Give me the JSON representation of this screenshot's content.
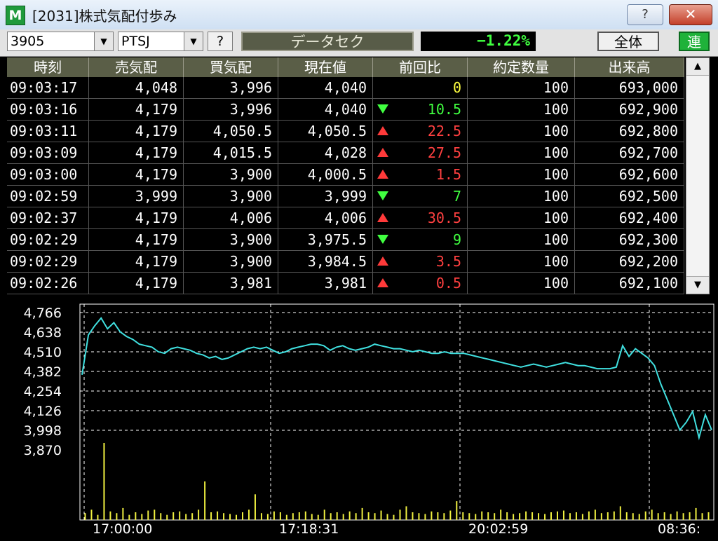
{
  "window": {
    "title": "[2031]株式気配付歩み",
    "app_icon": "M",
    "help_label": "?",
    "close_label": "✕"
  },
  "toolbar": {
    "code": "3905",
    "market": "PTSJ",
    "question_label": "?",
    "stock_name": "データセク",
    "change": "−1.22%",
    "all_label": "全体",
    "link_label": "連"
  },
  "table": {
    "headers": [
      "時刻",
      "売気配",
      "買気配",
      "現在値",
      "前回比",
      "約定数量",
      "出来高"
    ],
    "rows": [
      {
        "time": "09:03:17",
        "ask": "4,048",
        "bid": "3,996",
        "price": "4,040",
        "dir": "zero",
        "diff": "0",
        "qty": "100",
        "volume": "693,000"
      },
      {
        "time": "09:03:16",
        "ask": "4,179",
        "bid": "3,996",
        "price": "4,040",
        "dir": "dn",
        "diff": "10.5",
        "qty": "100",
        "volume": "692,900"
      },
      {
        "time": "09:03:11",
        "ask": "4,179",
        "bid": "4,050.5",
        "price": "4,050.5",
        "dir": "up",
        "diff": "22.5",
        "qty": "100",
        "volume": "692,800"
      },
      {
        "time": "09:03:09",
        "ask": "4,179",
        "bid": "4,015.5",
        "price": "4,028",
        "dir": "up",
        "diff": "27.5",
        "qty": "100",
        "volume": "692,700"
      },
      {
        "time": "09:03:00",
        "ask": "4,179",
        "bid": "3,900",
        "price": "4,000.5",
        "dir": "up",
        "diff": "1.5",
        "qty": "100",
        "volume": "692,600"
      },
      {
        "time": "09:02:59",
        "ask": "3,999",
        "bid": "3,900",
        "price": "3,999",
        "dir": "dn",
        "diff": "7",
        "qty": "100",
        "volume": "692,500"
      },
      {
        "time": "09:02:37",
        "ask": "4,179",
        "bid": "4,006",
        "price": "4,006",
        "dir": "up",
        "diff": "30.5",
        "qty": "100",
        "volume": "692,400"
      },
      {
        "time": "09:02:29",
        "ask": "4,179",
        "bid": "3,900",
        "price": "3,975.5",
        "dir": "dn",
        "diff": "9",
        "qty": "100",
        "volume": "692,300"
      },
      {
        "time": "09:02:29",
        "ask": "4,179",
        "bid": "3,900",
        "price": "3,984.5",
        "dir": "up",
        "diff": "3.5",
        "qty": "100",
        "volume": "692,200"
      },
      {
        "time": "09:02:26",
        "ask": "4,179",
        "bid": "3,981",
        "price": "3,981",
        "dir": "up",
        "diff": "0.5",
        "qty": "100",
        "volume": "692,100"
      }
    ]
  },
  "scrollbar": {
    "up_arrow": "▲",
    "down_arrow": "▼"
  },
  "colors": {
    "price_line": "#40e0e0",
    "volume_bar": "#f0f040",
    "grid": "#ffffff",
    "up": "#ff4040",
    "down": "#40ff40",
    "unchanged": "#ffff40"
  },
  "chart_data": {
    "type": "line",
    "y_ticks": [
      "4,766",
      "4,638",
      "4,510",
      "4,382",
      "4,254",
      "4,126",
      "3,998",
      "3,870"
    ],
    "y_tick_values": [
      4766,
      4638,
      4510,
      4382,
      4254,
      4126,
      3998,
      3870
    ],
    "x_ticks": [
      "17:00:00",
      "17:18:31",
      "20:02:59",
      "08:36:"
    ],
    "ylim": [
      3870,
      4766
    ],
    "price_series": [
      4360,
      4620,
      4680,
      4730,
      4660,
      4700,
      4640,
      4610,
      4590,
      4560,
      4550,
      4540,
      4510,
      4500,
      4530,
      4540,
      4530,
      4520,
      4500,
      4490,
      4470,
      4480,
      4460,
      4470,
      4490,
      4510,
      4530,
      4540,
      4530,
      4540,
      4520,
      4500,
      4510,
      4530,
      4540,
      4550,
      4560,
      4560,
      4550,
      4520,
      4540,
      4550,
      4530,
      4520,
      4530,
      4540,
      4560,
      4550,
      4540,
      4530,
      4530,
      4520,
      4510,
      4520,
      4510,
      4500,
      4500,
      4510,
      4500,
      4500,
      4500,
      4490,
      4480,
      4470,
      4460,
      4450,
      4440,
      4430,
      4420,
      4410,
      4420,
      4430,
      4420,
      4410,
      4420,
      4430,
      4440,
      4430,
      4420,
      4420,
      4410,
      4400,
      4400,
      4400,
      4410,
      4550,
      4480,
      4530,
      4500,
      4470,
      4420,
      4300,
      4200,
      4100,
      4000,
      4050,
      4120,
      3950,
      4100,
      4000
    ],
    "volume_series": [
      8,
      12,
      6,
      90,
      10,
      8,
      14,
      6,
      9,
      7,
      11,
      12,
      8,
      6,
      9,
      10,
      7,
      8,
      12,
      45,
      9,
      10,
      8,
      7,
      6,
      9,
      12,
      30,
      8,
      7,
      10,
      9,
      6,
      8,
      9,
      10,
      7,
      6,
      12,
      8,
      9,
      7,
      10,
      8,
      14,
      9,
      8,
      11,
      7,
      6,
      12,
      16,
      9,
      8,
      7,
      10,
      9,
      8,
      11,
      22,
      9,
      8,
      7,
      10,
      9,
      8,
      12,
      9,
      7,
      8,
      10,
      9,
      8,
      7,
      9,
      10,
      11,
      8,
      9,
      7,
      10,
      12,
      8,
      9,
      10,
      16,
      9,
      8,
      7,
      10,
      12,
      8,
      9,
      7,
      10,
      8,
      9,
      14,
      8,
      9
    ]
  }
}
